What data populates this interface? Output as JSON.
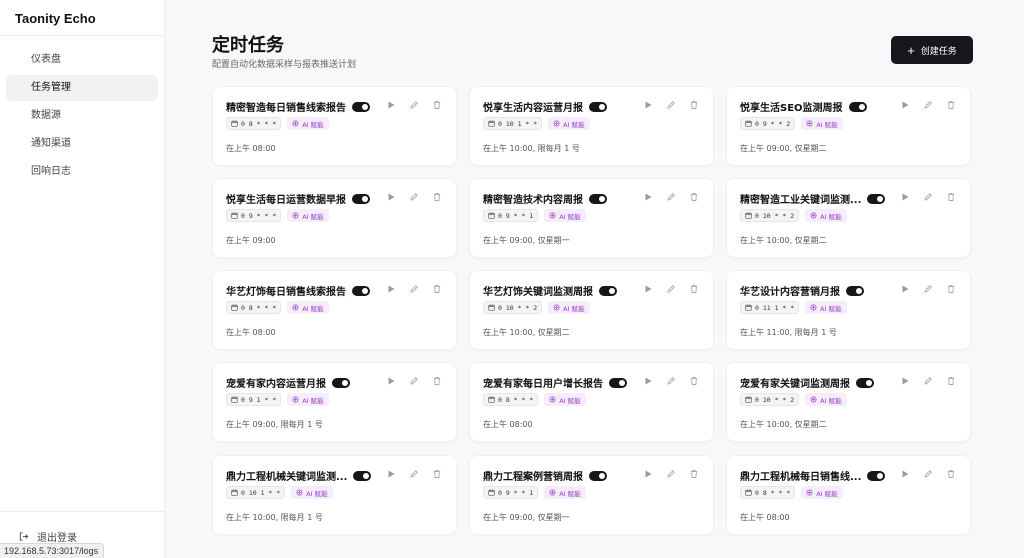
{
  "app": {
    "title": "Taonity Echo"
  },
  "sidebar": {
    "items": [
      {
        "label": "仪表盘",
        "active": false
      },
      {
        "label": "任务管理",
        "active": true
      },
      {
        "label": "数据源",
        "active": false
      },
      {
        "label": "通知渠道",
        "active": false
      },
      {
        "label": "回响日志",
        "active": false
      }
    ],
    "logout_label": "退出登录"
  },
  "status_url": "192.168.5.73:3017/logs",
  "header": {
    "title": "定时任务",
    "subtitle": "配置自动化数据采样与报表推送计划",
    "create_label": "创建任务"
  },
  "ai_label": "AI 赋能",
  "tasks": [
    {
      "title": "精密智造每日销售线索报告",
      "cron": "0 8 * * *",
      "schedule": "在上午 08:00"
    },
    {
      "title": "悦享生活内容运营月报",
      "cron": "0 10 1 * *",
      "schedule": "在上午 10:00, 限每月 1 号"
    },
    {
      "title": "悦享生活SEO监测周报",
      "cron": "0 9 * * 2",
      "schedule": "在上午 09:00, 仅星期二"
    },
    {
      "title": "悦享生活每日运营数据早报",
      "cron": "0 9 * * *",
      "schedule": "在上午 09:00"
    },
    {
      "title": "精密智造技术内容周报",
      "cron": "0 9 * * 1",
      "schedule": "在上午 09:00, 仅星期一"
    },
    {
      "title": "精密智造工业关键词监测...",
      "cron": "0 10 * * 2",
      "schedule": "在上午 10:00, 仅星期二"
    },
    {
      "title": "华艺灯饰每日销售线索报告",
      "cron": "0 8 * * *",
      "schedule": "在上午 08:00"
    },
    {
      "title": "华艺灯饰关键词监测周报",
      "cron": "0 10 * * 2",
      "schedule": "在上午 10:00, 仅星期二"
    },
    {
      "title": "华艺设计内容营销月报",
      "cron": "0 11 1 * *",
      "schedule": "在上午 11:00, 限每月 1 号"
    },
    {
      "title": "宠爱有家内容运营月报",
      "cron": "0 9 1 * *",
      "schedule": "在上午 09:00, 限每月 1 号"
    },
    {
      "title": "宠爱有家每日用户增长报告",
      "cron": "0 8 * * *",
      "schedule": "在上午 08:00"
    },
    {
      "title": "宠爱有家关键词监测周报",
      "cron": "0 10 * * 2",
      "schedule": "在上午 10:00, 仅星期二"
    },
    {
      "title": "鼎力工程机械关键词监测...",
      "cron": "0 10 1 * *",
      "schedule": "在上午 10:00, 限每月 1 号"
    },
    {
      "title": "鼎力工程案例营销周报",
      "cron": "0 9 * * 1",
      "schedule": "在上午 09:00, 仅星期一"
    },
    {
      "title": "鼎力工程机械每日销售线...",
      "cron": "0 8 * * *",
      "schedule": "在上午 08:00"
    }
  ]
}
